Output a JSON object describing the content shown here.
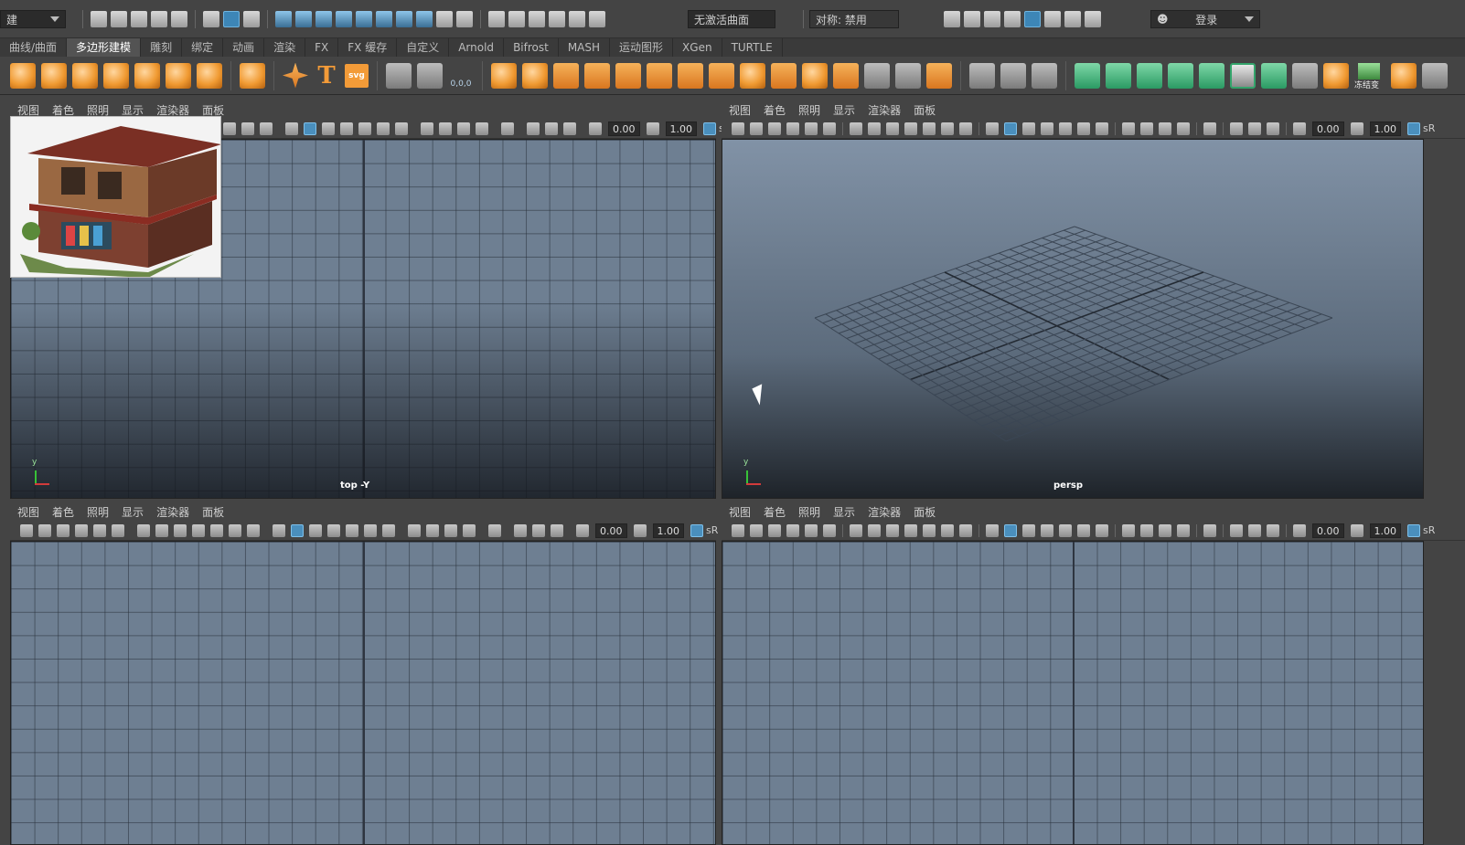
{
  "status": {
    "mode_dropdown": "建",
    "no_live_surface": "无激活曲面",
    "symmetry": "对称: 禁用",
    "login": "登录"
  },
  "shelf_tabs": [
    "曲线/曲面",
    "多边形建模",
    "雕刻",
    "绑定",
    "动画",
    "渲染",
    "FX",
    "FX 缓存",
    "自定义",
    "Arnold",
    "Bifrost",
    "MASH",
    "运动图形",
    "XGen",
    "TURTLE"
  ],
  "shelf_active_tab": "多边形建模",
  "shelf": {
    "text_tool": "T",
    "svg_tool": "svg",
    "coords": "0,0,0",
    "freeze_label": "冻结变"
  },
  "panel_menu": [
    "视图",
    "着色",
    "照明",
    "显示",
    "渲染器",
    "面板"
  ],
  "toolbar_values": {
    "exposure": "0.00",
    "gamma": "1.00",
    "color_space": "sR"
  },
  "viewports": {
    "top_left": {
      "camera": "top -Y",
      "axis_label": "y"
    },
    "top_right": {
      "camera": "persp",
      "axis_label": "y"
    },
    "bottom_left": {
      "camera": ""
    },
    "bottom_right": {
      "camera": ""
    }
  },
  "colors": {
    "viewport_bg": "#6e7f92",
    "accent_blue": "#4a8fbd",
    "shelf_orange": "#f39b38",
    "shelf_green": "#34a46b"
  }
}
